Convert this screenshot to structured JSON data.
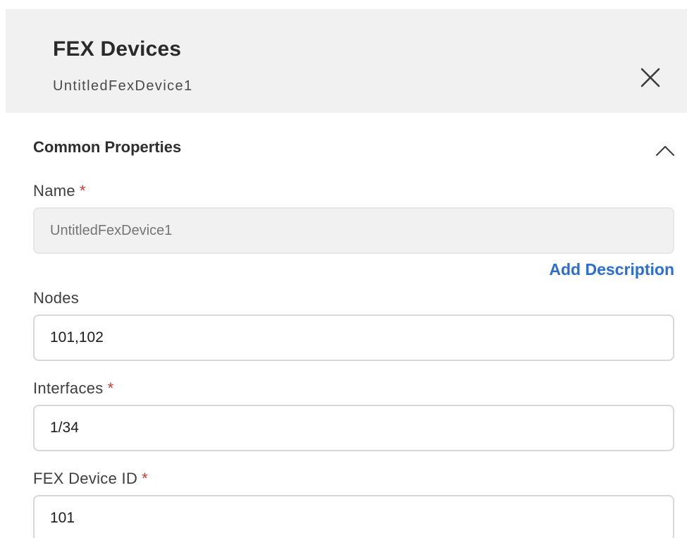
{
  "header": {
    "title": "FEX Devices",
    "subtitle": "UntitledFexDevice1"
  },
  "section": {
    "title": "Common Properties"
  },
  "fields": {
    "name": {
      "label": "Name",
      "required_mark": "*",
      "placeholder": "UntitledFexDevice1",
      "value": ""
    },
    "add_description_label": "Add Description",
    "nodes": {
      "label": "Nodes",
      "value": "101,102"
    },
    "interfaces": {
      "label": "Interfaces",
      "required_mark": "*",
      "value": "1/34"
    },
    "fex_device_id": {
      "label": "FEX Device ID",
      "required_mark": "*",
      "value": "101"
    }
  },
  "icons": {
    "close": "close-icon",
    "collapse": "chevron-up-icon"
  },
  "colors": {
    "header_bg": "#f1f1f1",
    "link": "#2c6fd0",
    "required": "#d13a32"
  }
}
